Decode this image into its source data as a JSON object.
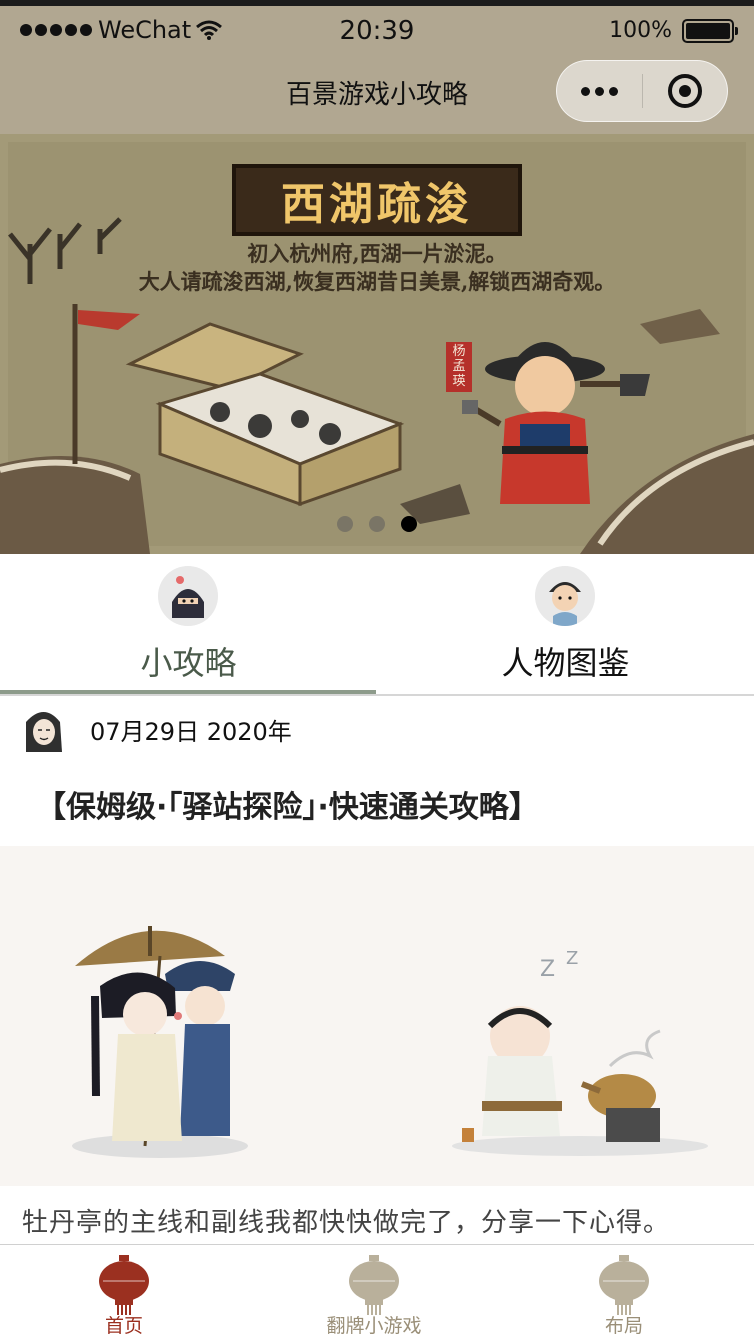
{
  "status_bar": {
    "carrier": "WeChat",
    "time": "20:39",
    "battery": "100%"
  },
  "nav": {
    "title": "百景游戏小攻略"
  },
  "banner": {
    "title": "西湖疏浚",
    "line1": "初入杭州府,西湖一片淤泥。",
    "line2": "大人请疏浚西湖,恢复西湖昔日美景,解锁西湖奇观。",
    "seal_text": "杨孟瑛",
    "dots": [
      false,
      false,
      true
    ]
  },
  "tabs": [
    {
      "label": "小攻略",
      "active": true,
      "icon": "ninja-avatar-icon"
    },
    {
      "label": "人物图鉴",
      "active": false,
      "icon": "official-avatar-icon"
    }
  ],
  "post": {
    "date": "07月29日 2020年",
    "title": "【保姆级·「驿站探险」·快速通关攻略】",
    "text": "牡丹亭的主线和副线我都快快做完了，分享一下心得。"
  },
  "tabbar": {
    "items": [
      {
        "label": "首页",
        "icon": "lantern-icon",
        "active": true
      },
      {
        "label": "翻牌小游戏",
        "icon": "lantern-icon",
        "active": false
      },
      {
        "label": "布局",
        "icon": "lantern-icon",
        "active": false
      }
    ],
    "active_color": "#9b3020",
    "inactive_color": "#b9b09b"
  },
  "colors": {
    "header_bg": "#b1a791",
    "tab_underline": "#8d9b8b"
  }
}
